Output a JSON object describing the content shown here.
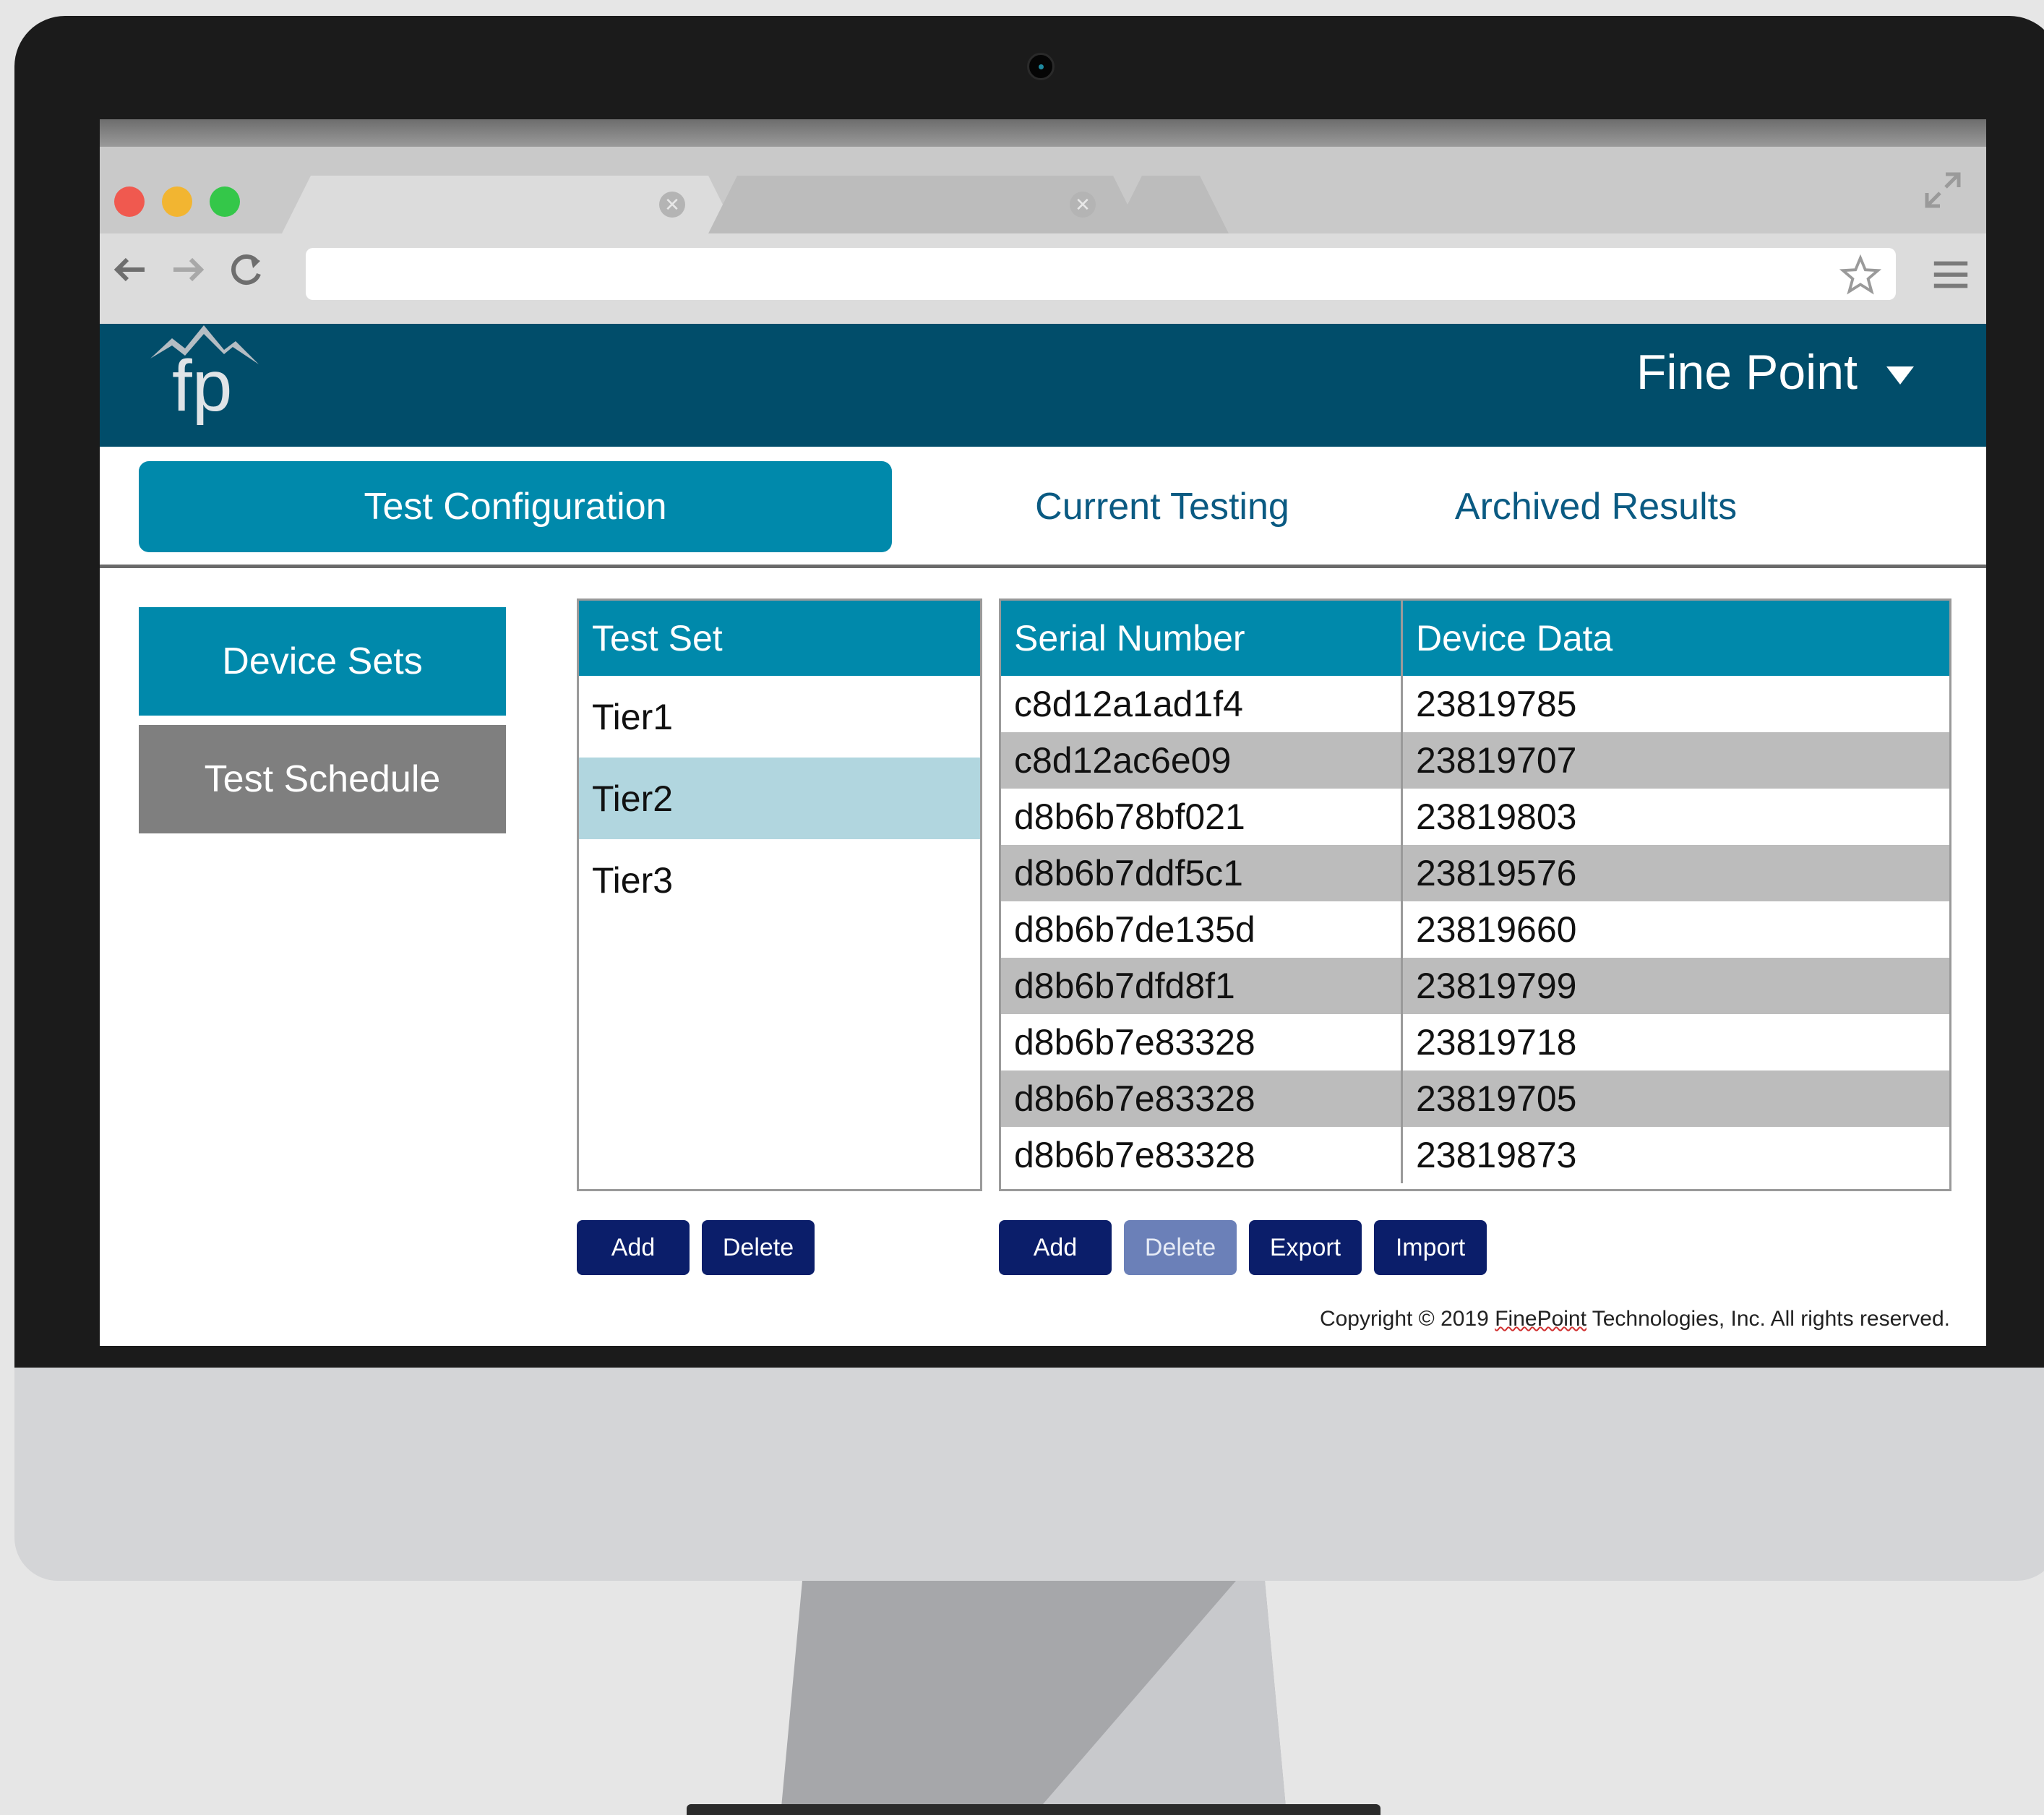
{
  "browser": {
    "tabs": [
      {
        "label": "",
        "close_glyph": "✕"
      },
      {
        "label": "",
        "close_glyph": "✕"
      }
    ],
    "url": ""
  },
  "colors": {
    "header_bg": "#014d6a",
    "accent": "#0089ab",
    "button_bg": "#0b1e6a",
    "button_disabled_bg": "#6b80b8",
    "selected_row_bg": "#b1d6df",
    "striped_row_bg": "#bcbcbc"
  },
  "header": {
    "logo_text": "fp",
    "account_name": "Fine Point"
  },
  "main_tabs": [
    {
      "label": "Test Configuration",
      "active": true
    },
    {
      "label": "Current Testing",
      "active": false
    },
    {
      "label": "Archived Results",
      "active": false
    }
  ],
  "sidebar": {
    "items": [
      {
        "label": "Device Sets",
        "active": true
      },
      {
        "label": "Test Schedule",
        "active": false
      }
    ]
  },
  "test_set": {
    "header": "Test Set",
    "rows": [
      {
        "label": "Tier1",
        "selected": false
      },
      {
        "label": "Tier2",
        "selected": true
      },
      {
        "label": "Tier3",
        "selected": false
      }
    ],
    "buttons": {
      "add": "Add",
      "delete": "Delete"
    }
  },
  "devices": {
    "columns": {
      "serial": "Serial Number",
      "data": "Device Data"
    },
    "rows": [
      {
        "serial": "c8d12a1ad1f4",
        "data": "23819785"
      },
      {
        "serial": "c8d12ac6e09",
        "data": "23819707"
      },
      {
        "serial": "d8b6b78bf021",
        "data": "23819803"
      },
      {
        "serial": "d8b6b7ddf5c1",
        "data": "23819576"
      },
      {
        "serial": "d8b6b7de135d",
        "data": "23819660"
      },
      {
        "serial": "d8b6b7dfd8f1",
        "data": "23819799"
      },
      {
        "serial": "d8b6b7e83328",
        "data": "23819718"
      },
      {
        "serial": "d8b6b7e83328",
        "data": "23819705"
      },
      {
        "serial": "d8b6b7e83328",
        "data": "23819873"
      }
    ],
    "buttons": {
      "add": "Add",
      "delete": "Delete",
      "export": "Export",
      "import": "Import"
    }
  },
  "footer": {
    "copyright_prefix": "Copyright © 2019 ",
    "company": "FinePoint",
    "copyright_suffix": " Technologies, Inc.  All rights reserved."
  }
}
